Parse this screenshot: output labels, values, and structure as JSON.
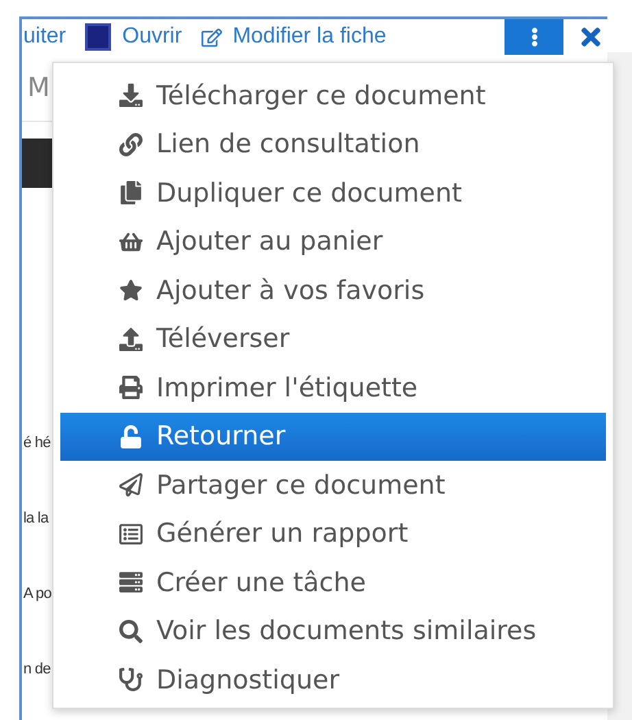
{
  "toolbar": {
    "items": [
      {
        "label": "uiter"
      },
      {
        "label": "Ouvrir"
      },
      {
        "label": "Modifier la fiche"
      }
    ]
  },
  "tab_fragment": "M",
  "text_fragments": [
    "é hé",
    "la la",
    "A po",
    "n de"
  ],
  "menu": {
    "items": [
      {
        "label": "Télécharger ce document",
        "selected": false
      },
      {
        "label": "Lien de consultation",
        "selected": false
      },
      {
        "label": "Dupliquer ce document",
        "selected": false
      },
      {
        "label": "Ajouter au panier",
        "selected": false
      },
      {
        "label": "Ajouter à vos favoris",
        "selected": false
      },
      {
        "label": "Téléverser",
        "selected": false
      },
      {
        "label": "Imprimer l'étiquette",
        "selected": false
      },
      {
        "label": "Retourner",
        "selected": true
      },
      {
        "label": "Partager ce document",
        "selected": false
      },
      {
        "label": "Générer un rapport",
        "selected": false
      },
      {
        "label": "Créer une tâche",
        "selected": false
      },
      {
        "label": "Voir les documents similaires",
        "selected": false
      },
      {
        "label": "Diagnostiquer",
        "selected": false
      }
    ]
  }
}
